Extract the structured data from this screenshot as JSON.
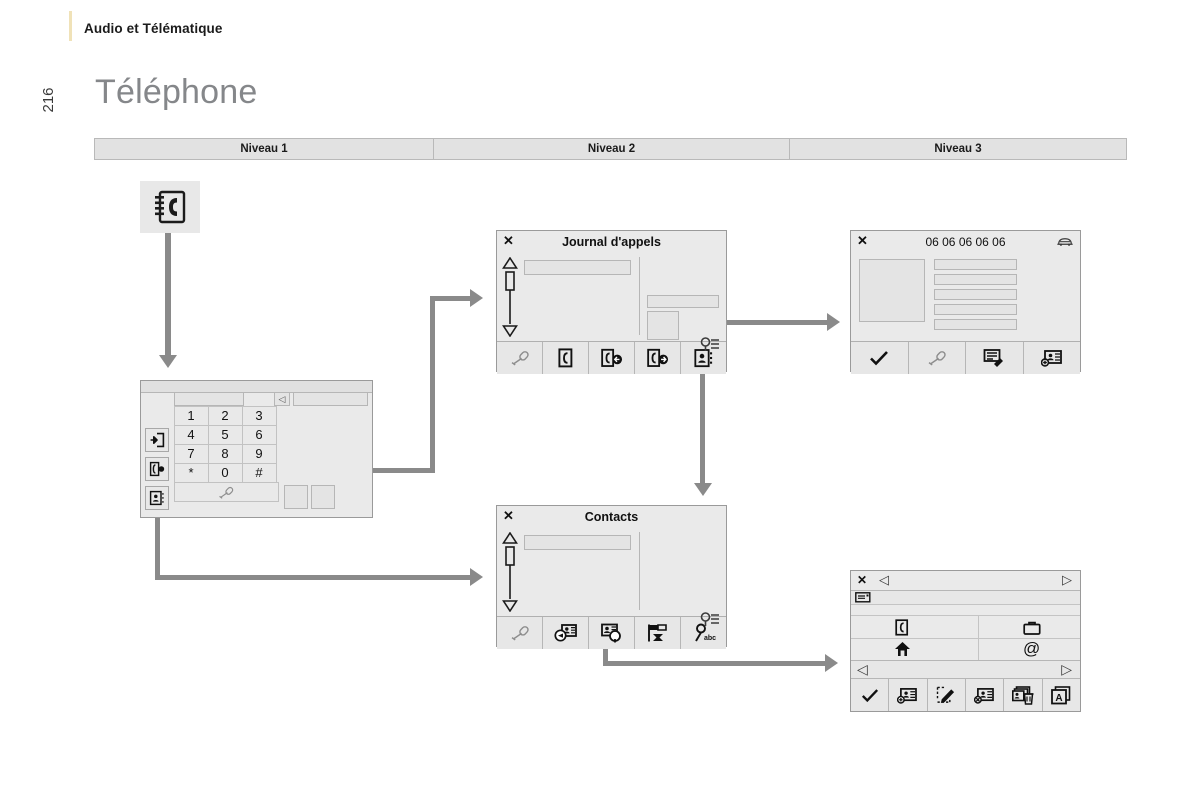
{
  "header": {
    "section": "Audio et Télématique",
    "page_number": "216",
    "title": "Téléphone"
  },
  "levels": [
    {
      "label": "Niveau 1"
    },
    {
      "label": "Niveau 2"
    },
    {
      "label": "Niveau 3"
    }
  ],
  "app_icon": {
    "name": "phonebook-icon"
  },
  "screens": {
    "keypad": {
      "name": "dial-keypad-screen",
      "backspace_label": "◁",
      "side_buttons": [
        {
          "name": "exit-icon"
        },
        {
          "name": "call-log-icon"
        },
        {
          "name": "contacts-icon"
        }
      ],
      "keys": [
        [
          "1",
          "2",
          "3"
        ],
        [
          "4",
          "5",
          "6"
        ],
        [
          "7",
          "8",
          "9"
        ],
        [
          "*",
          "0",
          "#"
        ]
      ],
      "call_button": {
        "name": "handset-icon"
      }
    },
    "call_log": {
      "name": "call-log-screen",
      "title": "Journal d'appels",
      "close_label": "✕",
      "options_icon": "options-magnifier-icon",
      "toolbar": [
        {
          "name": "handset-icon"
        },
        {
          "name": "call-missed-icon"
        },
        {
          "name": "call-received-icon"
        },
        {
          "name": "call-dialled-icon"
        },
        {
          "name": "contacts-icon"
        }
      ]
    },
    "call_detail": {
      "name": "call-detail-screen",
      "title": "06 06 06 06 06",
      "close_label": "✕",
      "status_icon": "car-icon",
      "rows": 5,
      "toolbar": [
        {
          "name": "validate-check-icon"
        },
        {
          "name": "handset-icon"
        },
        {
          "name": "edit-number-icon"
        },
        {
          "name": "add-contact-icon"
        }
      ]
    },
    "contacts": {
      "name": "contacts-screen",
      "title": "Contacts",
      "close_label": "✕",
      "options_icon": "options-magnifier-icon",
      "toolbar": [
        {
          "name": "handset-icon"
        },
        {
          "name": "send-contact-icon"
        },
        {
          "name": "search-contact-icon"
        },
        {
          "name": "sort-contacts-icon"
        },
        {
          "name": "alpha-search-icon",
          "sub_label": "abc"
        }
      ]
    },
    "contact_detail": {
      "name": "contact-detail-screen",
      "close_label": "✕",
      "prev_label": "◁",
      "next_label": "▷",
      "card_icon": "contact-card-icon",
      "nav_prev_label": "◁",
      "nav_next_label": "▷",
      "fields": [
        {
          "name": "mobile-phone-icon"
        },
        {
          "name": "work-briefcase-icon"
        },
        {
          "name": "home-house-icon"
        },
        {
          "name": "email-at-icon",
          "label": "@"
        }
      ],
      "toolbar": [
        {
          "name": "validate-check-icon"
        },
        {
          "name": "add-contact-icon"
        },
        {
          "name": "edit-contact-icon"
        },
        {
          "name": "delete-contact-icon"
        },
        {
          "name": "delete-all-contacts-icon"
        },
        {
          "name": "alpha-list-icon"
        }
      ]
    }
  },
  "colors": {
    "accent": "#f0e2b8",
    "connector": "#8a8a8a",
    "screen_bg": "#eaeaea",
    "title_gray": "#85878a",
    "table_header_bg": "#e2e2e2"
  }
}
